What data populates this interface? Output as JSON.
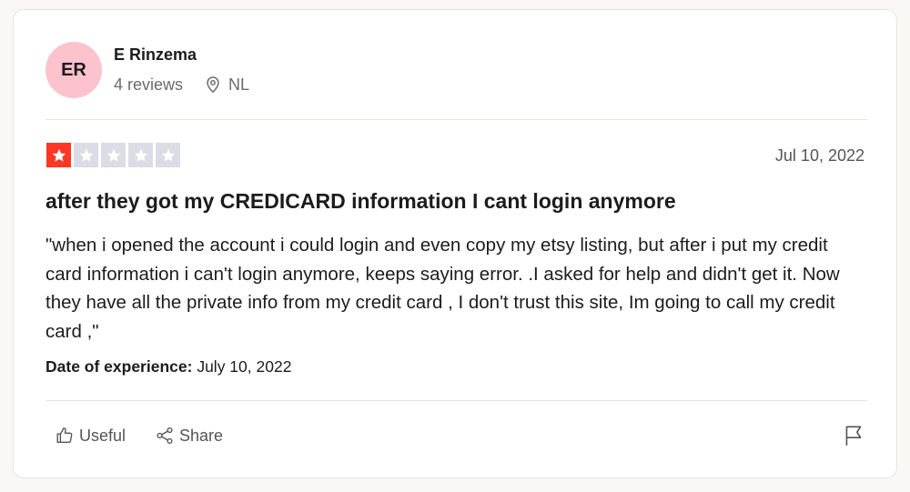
{
  "reviewer": {
    "initials": "ER",
    "name": "E Rinzema",
    "reviews_count": "4 reviews",
    "country": "NL",
    "avatar_color": "#fcc2ce",
    "location_icon": "map-pin-icon"
  },
  "review": {
    "rating": 1,
    "max_rating": 5,
    "date": "Jul 10, 2022",
    "title": "after they got my CREDICARD information I cant login anymore",
    "body": "\"when i opened the account i could login and even copy my etsy listing, but after i put my credit card information i can't login anymore, keeps saying error. .I asked for help and didn't get it. Now they have all the private info from my credit card , I don't trust this site, Im going to call my credit card ,\"",
    "experience_label": "Date of experience:",
    "experience_date": "July 10, 2022",
    "star_filled_color": "#ff3722",
    "star_empty_color": "#dcdce6"
  },
  "actions": {
    "useful_label": "Useful",
    "useful_icon": "thumbs-up-icon",
    "share_label": "Share",
    "share_icon": "share-icon",
    "report_icon": "flag-icon"
  }
}
